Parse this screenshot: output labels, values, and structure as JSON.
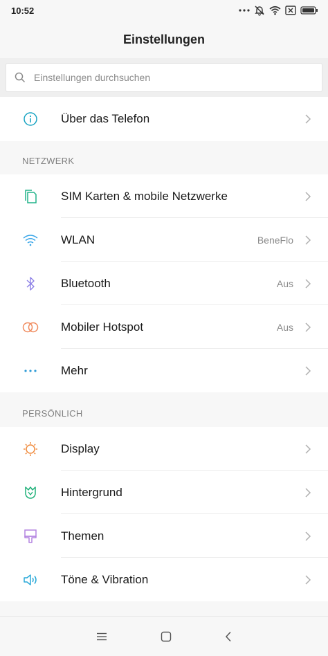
{
  "status_bar": {
    "time": "10:52",
    "icons": [
      "more-dots-icon",
      "silent-bell-icon",
      "wifi-icon",
      "sim-x-icon",
      "battery-icon"
    ]
  },
  "header": {
    "title": "Einstellungen"
  },
  "search": {
    "placeholder": "Einstellungen durchsuchen"
  },
  "top_group": {
    "items": [
      {
        "label": "Über das Telefon",
        "value": "",
        "icon": "info-icon",
        "color": "#1aa4c3"
      }
    ]
  },
  "network": {
    "header": "NETZWERK",
    "items": [
      {
        "label": "SIM Karten & mobile Netzwerke",
        "value": "",
        "icon": "sim-cards-icon",
        "color": "#21b38a"
      },
      {
        "label": "WLAN",
        "value": "BeneFlo",
        "icon": "wifi-icon",
        "color": "#3aa6e8"
      },
      {
        "label": "Bluetooth",
        "value": "Aus",
        "icon": "bluetooth-icon",
        "color": "#8c7fe6"
      },
      {
        "label": "Mobiler Hotspot",
        "value": "Aus",
        "icon": "hotspot-icon",
        "color": "#f08a5d"
      },
      {
        "label": "Mehr",
        "value": "",
        "icon": "more-dots-icon",
        "color": "#2e9bd6"
      }
    ]
  },
  "personal": {
    "header": "PERSÖNLICH",
    "items": [
      {
        "label": "Display",
        "value": "",
        "icon": "sun-icon",
        "color": "#f08a3c"
      },
      {
        "label": "Hintergrund",
        "value": "",
        "icon": "tulip-icon",
        "color": "#1fb079"
      },
      {
        "label": "Themen",
        "value": "",
        "icon": "brush-icon",
        "color": "#b383e0"
      },
      {
        "label": "Töne & Vibration",
        "value": "",
        "icon": "speaker-icon",
        "color": "#2aa9d8"
      }
    ]
  },
  "nav_bar": {
    "buttons": [
      "menu-icon",
      "home-icon",
      "back-icon"
    ]
  }
}
